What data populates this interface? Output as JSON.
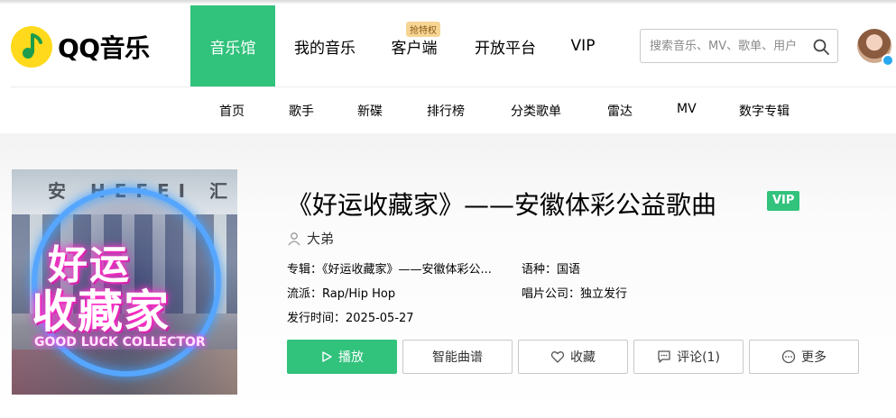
{
  "header": {
    "logo_text": "QQ音乐",
    "nav": [
      {
        "label": "音乐馆",
        "active": true
      },
      {
        "label": "我的音乐"
      },
      {
        "label": "客户端",
        "badge": "抢特权"
      },
      {
        "label": "开放平台"
      },
      {
        "label": "VIP"
      }
    ],
    "search_placeholder": "搜索音乐、MV、歌单、用户"
  },
  "subnav": [
    "首页",
    "歌手",
    "新碟",
    "排行榜",
    "分类歌单",
    "雷达",
    "MV",
    "数字专辑"
  ],
  "song": {
    "title": "《好运收藏家》——安徽体彩公益歌曲",
    "vip_tag": "VIP",
    "singer": "大弟",
    "album_label": "专辑：",
    "album_value": "《好运收藏家》——安徽体彩公...",
    "language_label": "语种：",
    "language_value": "国语",
    "genre_label": "流派：",
    "genre_value": "Rap/Hip Hop",
    "company_label": "唱片公司：",
    "company_value": "独立发行",
    "date_label": "发行时间：",
    "date_value": "2025-05-27"
  },
  "cover": {
    "top_text": "安 HEFEI 汇",
    "title_line1": "好运",
    "title_line2": "收藏家",
    "subtitle": "GOOD LUCK COLLECTOR"
  },
  "actions": {
    "play": "播放",
    "sheet": "智能曲谱",
    "favorite": "收藏",
    "comment": "评论(1)",
    "more": "更多"
  },
  "colors": {
    "accent": "#31c27c",
    "logo_yellow": "#ffd91b"
  }
}
